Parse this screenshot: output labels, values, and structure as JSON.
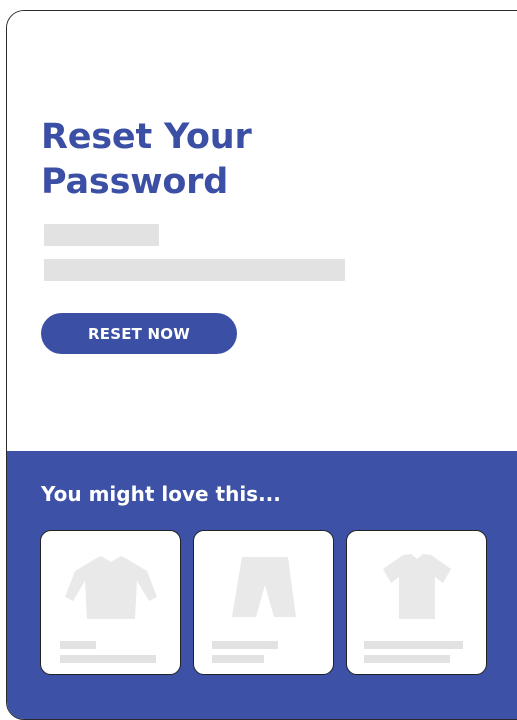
{
  "email": {
    "title": "Reset Your Password",
    "cta": {
      "label": "RESET NOW"
    },
    "recommendations": {
      "heading": "You might love this...",
      "products": [
        {
          "icon": "long-sleeve-shirt-icon"
        },
        {
          "icon": "shorts-icon"
        },
        {
          "icon": "tshirt-icon"
        }
      ]
    }
  },
  "colors": {
    "brand": "#3b4fa4",
    "panel": "#3d52a6",
    "placeholder": "#e2e2e2",
    "product_icon": "#e9e9e9"
  }
}
